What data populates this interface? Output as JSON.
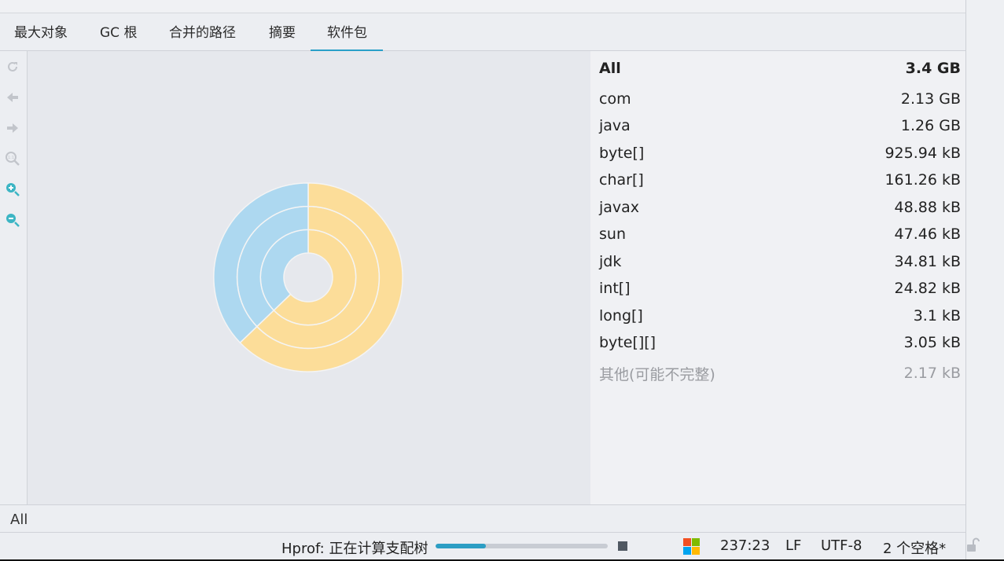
{
  "tabs": [
    {
      "label": "最大对象",
      "active": false
    },
    {
      "label": "GC 根",
      "active": false
    },
    {
      "label": "合并的路径",
      "active": false
    },
    {
      "label": "摘要",
      "active": false
    },
    {
      "label": "软件包",
      "active": true
    }
  ],
  "toolbar": {
    "icons": [
      "refresh-icon",
      "back-arrow-icon",
      "forward-arrow-icon",
      "zoom-reset-icon",
      "zoom-in-icon",
      "zoom-out-icon"
    ]
  },
  "chart_data": {
    "type": "pie",
    "rings": 3,
    "slices": [
      {
        "label": "com",
        "value": 2.13,
        "color": "#fcdd99"
      },
      {
        "label": "java",
        "value": 1.26,
        "color": "#add8f0"
      }
    ]
  },
  "packages": {
    "header": {
      "name": "All",
      "size": "3.4 GB"
    },
    "rows": [
      {
        "name": "com",
        "size": "2.13 GB"
      },
      {
        "name": "java",
        "size": "1.26 GB"
      },
      {
        "name": "byte[]",
        "size": "925.94 kB"
      },
      {
        "name": "char[]",
        "size": "161.26 kB"
      },
      {
        "name": "javax",
        "size": "48.88 kB"
      },
      {
        "name": "sun",
        "size": "47.46 kB"
      },
      {
        "name": "jdk",
        "size": "34.81 kB"
      },
      {
        "name": "int[]",
        "size": "24.82 kB"
      },
      {
        "name": "long[]",
        "size": "3.1 kB"
      },
      {
        "name": "byte[][]",
        "size": "3.05 kB"
      }
    ],
    "other": {
      "name": "其他(可能不完整)",
      "size": "2.17 kB"
    }
  },
  "breadcrumb": {
    "label": "All"
  },
  "status": {
    "task": "Hprof: 正在计算支配树",
    "progress": 0.29,
    "position": "237:23",
    "line_ending": "LF",
    "encoding": "UTF-8",
    "indent": "2 个空格*"
  },
  "colors": {
    "accent": "#2aa0c8",
    "com": "#fcdd99",
    "java": "#add8f0"
  }
}
